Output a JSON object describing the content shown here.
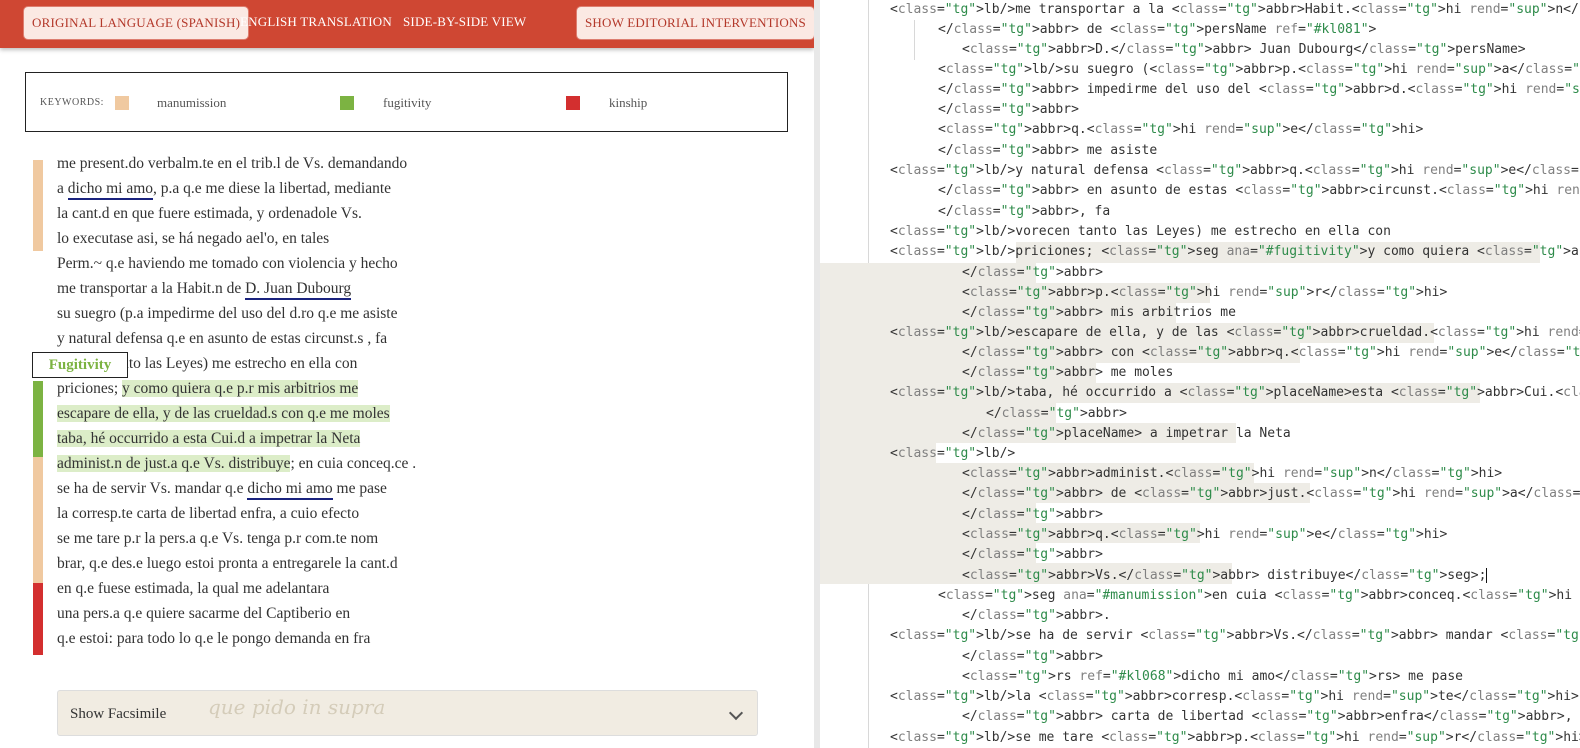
{
  "toolbar": {
    "original_language": "ORIGINAL LANGUAGE (SPANISH)",
    "english_translation": "ENGLISH TRANSLATION",
    "side_by_side": "SIDE-BY-SIDE VIEW",
    "show_editorial": "SHOW EDITORIAL INTERVENTIONS"
  },
  "keywords": {
    "title": "KEYWORDS:",
    "items": [
      {
        "label": "manumission",
        "color": "#f0c9a0"
      },
      {
        "label": "fugitivity",
        "color": "#7cb342"
      },
      {
        "label": "kinship",
        "color": "#d32f2f"
      }
    ]
  },
  "annotation_tag": "Fugitivity",
  "transcription": {
    "lines": [
      "me present.do verbalm.te en el trib.l de Vs. demandando",
      [
        "a ",
        "dicho mi amo",
        ", p.a q.e me diese la libertad, mediante"
      ],
      "la cant.d en que fuere estimada, y ordenadole Vs.",
      "lo executase asi, se há negado ael'o, en tales",
      "Perm.~ q.e haviendo me tomado con violencia y hecho",
      [
        "me transportar a la Habit.n de ",
        "D. Juan Dubourg",
        ""
      ],
      "su suegro (p.a impedirme del uso del d.ro q.e me asiste",
      "y natural defensa q.e en asunto de estas circunst.s , fa",
      "vorecen tanto las Leyes) me estrecho en ella con",
      [
        "priciones; ",
        "y como quiera q.e p.r mis arbitrios me",
        ""
      ],
      [
        "",
        "escapare de ella, y de las crueldad.s con q.e me moles",
        ""
      ],
      [
        "",
        "taba, hé occurrido a esta Cui.d a impetrar la Neta",
        ""
      ],
      [
        "",
        "administ.n de just.a q.e Vs. distribuye",
        "; en cuia conceq.ce ."
      ],
      [
        "se ha de servir Vs. mandar q.e ",
        "dicho mi amo",
        " me pase"
      ],
      "la corresp.te carta de libertad enfra, a cuio efecto",
      "se me tare p.r la pers.a q.e Vs. tenga p.r com.te nom",
      "brar, q.e des.e luego estoi pronta a entregarele la cant.d",
      "en q.e fuese estimada, la qual me adelantara",
      "una pers.a q.e quiere sacarme del Captiberio en",
      "q.e estoi: para todo lo q.e le pongo demanda en fra"
    ]
  },
  "facsimile": {
    "label": "Show Facsimile",
    "handwriting": "que pido in supra"
  },
  "code": {
    "lines": [
      "<lb/>me transportar a la <abbr>Habit.<hi rend=\"sup\">n</hi>",
      "</abbr> de <persName ref=\"#kl081\">",
      "<abbr>D.</abbr> Juan Dubourg</persName>",
      "<lb/>su suegro (<abbr>p.<hi rend=\"sup\">a</hi>",
      "</abbr> impedirme del uso del <abbr>d.<hi rend=\"sup\">ro</hi>",
      "</abbr>",
      "<abbr>q.<hi rend=\"sup\">e</hi>",
      "</abbr> me asiste",
      "<lb/>y natural defensa <abbr>q.<hi rend=\"sup\">e</hi>",
      "</abbr> en asunto de estas <abbr>circunst.<hi rend=\"sup\">s</hi>",
      "</abbr>, fa",
      "<lb/>vorecen tanto las Leyes) me estrecho en ella con",
      "<lb/>priciones; <seg ana=\"#fugitivity\">y como quiera <abbr>q.<hi rend=\"sup\">e</hi>",
      "</abbr>",
      "<abbr>p.<hi rend=\"sup\">r</hi>",
      "</abbr> mis arbitrios me",
      "<lb/>escapare de ella, y de las <abbr>crueldad.<hi rend=\"sup\">s</hi>",
      "</abbr> con <abbr>q.<hi rend=\"sup\">e</hi>",
      "</abbr> me moles",
      "<lb/>taba, hé occurrido a <placeName>esta <abbr>Cui.<hi rend=\"sup\">d</hi>",
      "</abbr>",
      "</placeName> a impetrar la Neta",
      "<lb/>",
      "<abbr>administ.<hi rend=\"sup\">n</hi>",
      "</abbr> de <abbr>just.<hi rend=\"sup\">a</hi>",
      "</abbr>",
      "<abbr>q.<hi rend=\"sup\">e</hi>",
      "</abbr>",
      "<abbr>Vs.</abbr> distribuye</seg>;",
      "<seg ana=\"#manumission\">en cuia <abbr>conceq.<hi rend=\"sup\">ce</hi>",
      "</abbr>.",
      "<lb/>se ha de servir <abbr>Vs.</abbr> mandar <abbr>q.<hi rend=\"sup\">e</hi>",
      "</abbr>",
      "<rs ref=\"#kl068\">dicho mi amo</rs> me pase",
      "<lb/>la <abbr>corresp.<hi rend=\"sup\">te</hi>",
      "</abbr> carta de libertad <abbr>enfra</abbr>, a cuio efecto",
      "<lb/>se me tare <abbr>p.<hi rend=\"sup\">r</hi>"
    ]
  }
}
